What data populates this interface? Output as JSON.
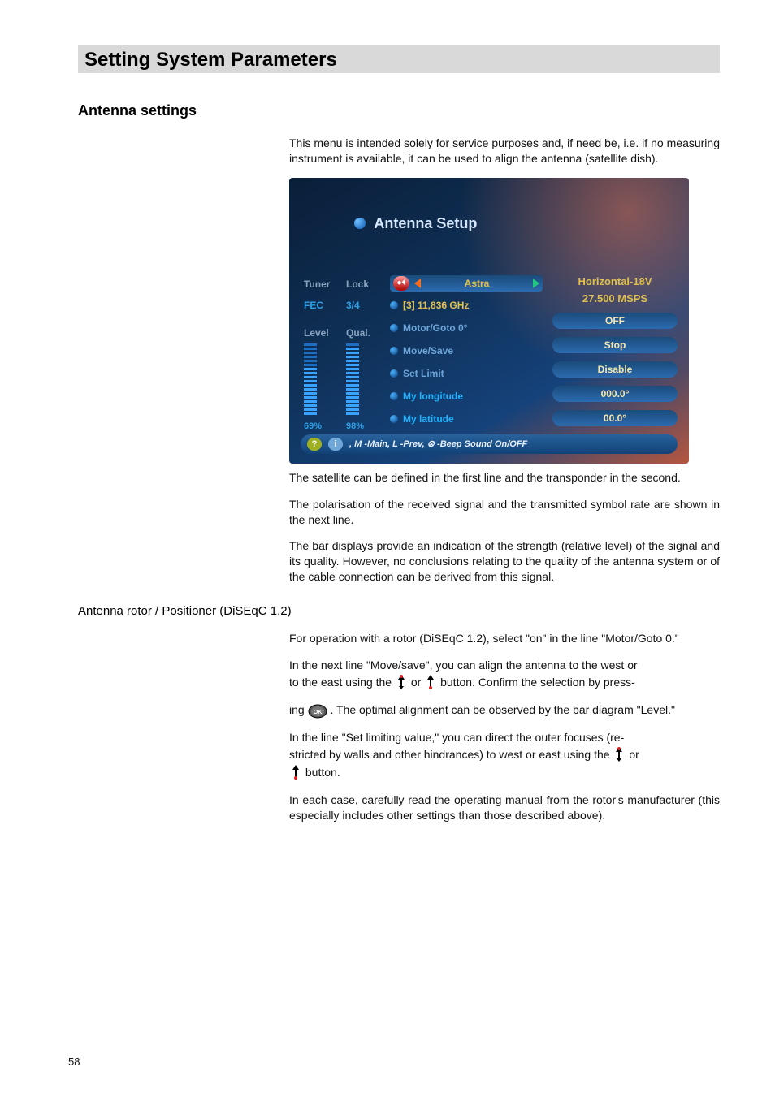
{
  "header": "Setting System Parameters",
  "section_title": "Antenna settings",
  "intro": "This menu is intended solely for service purposes and, if need be, i.e. if no measuring instrument is available, it can be used to align the antenna (satellite dish).",
  "screenshot": {
    "title": "Antenna Setup",
    "labels": {
      "tuner": "Tuner",
      "lock": "Lock",
      "fec": "FEC",
      "fec_value": "3/4",
      "level": "Level",
      "qual": "Qual."
    },
    "level_pct": "69%",
    "qual_pct": "98%",
    "astra": "Astra",
    "freq": "[3] 11,836 GHz",
    "motor": "Motor/Goto 0°",
    "move": "Move/Save",
    "setlimit": "Set Limit",
    "mylon": "My longitude",
    "mylat": "My latitude",
    "right": {
      "pol": "Horizontal-18V",
      "msps": "27.500 MSPS",
      "off": "OFF",
      "stop": "Stop",
      "disable": "Disable",
      "lon": "000.0°",
      "lat": "00.0°"
    },
    "footer": ", M -Main, L -Prev, ⊗ -Beep Sound On/OFF"
  },
  "para1": "The satellite can be defined in the first line and the transponder in the second.",
  "para2": "The polarisation of the received signal and the transmitted symbol rate are shown in the next line.",
  "para3": "The bar displays provide an indication of the strength (relative level) of the signal and its quality. However, no conclusions relating to the quality of the antenna system or of the cable connection can be derived from this signal.",
  "subtitle": "Antenna rotor / Positioner (DiSEqC 1.2)",
  "sub1": "For operation with a rotor (DiSEqC 1.2), select \"on\" in the line \"Motor/Goto 0.\"",
  "sub2_a": "In the next line \"Move/save\", you can align the antenna to the west or",
  "sub2_b": "to the east using the ",
  "sub2_c": " or ",
  "sub2_d": " button.  Confirm the selection by press-",
  "sub3_a": "ing ",
  "sub3_b": ". The optimal alignment can be observed by the bar diagram \"Level.\"",
  "sub4_a": "In the line \"Set limiting value,\" you can direct the outer focuses (re-",
  "sub4_b": "stricted by walls and other hindrances) to west or east using the ",
  "sub4_c": " or",
  "sub4_d": " button.",
  "sub5": "In each case, carefully read the operating manual from the rotor's manufacturer (this especially includes other settings than those described above).",
  "page_num": "58"
}
